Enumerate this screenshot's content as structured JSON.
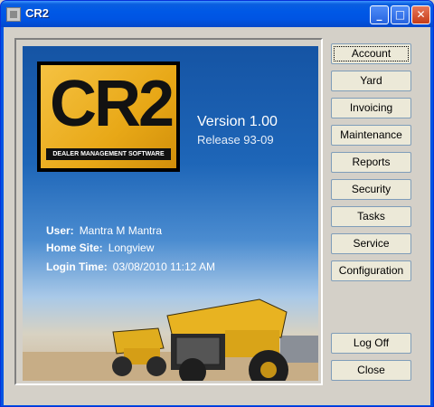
{
  "window": {
    "title": "CR2"
  },
  "logo": {
    "text": "CR2",
    "subtitle": "DEALER MANAGEMENT SOFTWARE"
  },
  "version": {
    "version": "Version 1.00",
    "release": "Release 93-09"
  },
  "session": {
    "user_label": "User:",
    "user": "Mantra M Mantra",
    "site_label": "Home Site:",
    "site": "Longview",
    "login_label": "Login Time:",
    "login": "03/08/2010 11:12 AM"
  },
  "buttons": {
    "main": [
      "Account",
      "Yard",
      "Invoicing",
      "Maintenance",
      "Reports",
      "Security",
      "Tasks",
      "Service",
      "Configuration"
    ],
    "logoff": "Log Off",
    "close": "Close"
  },
  "colors": {
    "titlebar": "#0054e3",
    "logo": "#e8a817",
    "hero_top": "#1554a4"
  }
}
